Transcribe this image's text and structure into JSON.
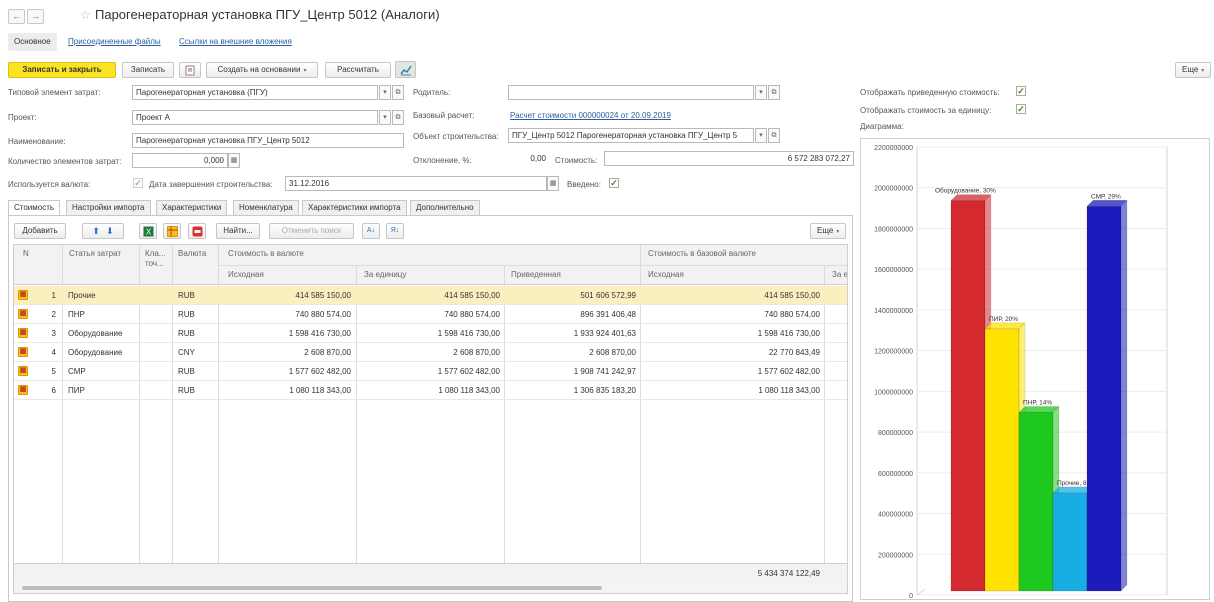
{
  "window": {
    "title": "Парогенераторная установка ПГУ_Центр 5012 (Аналоги)",
    "back_glyph": "←",
    "forward_glyph": "→",
    "star_glyph": "☆"
  },
  "top_tabs": [
    {
      "label": "Основное"
    },
    {
      "label": "Присоединенные файлы"
    },
    {
      "label": "Ссылки на внешние вложения"
    }
  ],
  "toolbar": {
    "save_close": "Записать и закрыть",
    "save": "Записать",
    "create_based": "Создать на основании",
    "calculate": "Рассчитать",
    "more": "Еще"
  },
  "form": {
    "typical_element_label": "Типовой элемент затрат:",
    "typical_element_value": "Парогенераторная установка (ПГУ)",
    "project_label": "Проект:",
    "project_value": "Проект А",
    "name_label": "Наименование:",
    "name_value": "Парогенераторная установка ПГУ_Центр 5012",
    "count_label": "Количество элементов затрат:",
    "count_value": "0,000",
    "currency_label": "Используется валюта:",
    "completion_label": "Дата завершения строительства:",
    "completion_value": "31.12.2016",
    "introduced_label": "Введено:",
    "parent_label": "Родитель:",
    "parent_value": "",
    "base_calc_label": "Базовый расчет:",
    "base_calc_value": "Расчет стоимости 000000024 от 20.09.2019",
    "object_label": "Объект строительства:",
    "object_value": "ПГУ_Центр 5012  Парогенераторная установка ПГУ_Центр 5",
    "deviation_label": "Отклонение, %:",
    "deviation_value": "0,00",
    "cost_label": "Стоимость:",
    "cost_value": "6 572 283 072,27"
  },
  "right_panel": {
    "show_reduced_label": "Отображать приведенную стоимость:",
    "show_unit_label": "Отображать стоимость за единицу:",
    "diagram_label": "Диаграмма:"
  },
  "inner_tabs": [
    {
      "label": "Стоимость"
    },
    {
      "label": "Настройки импорта"
    },
    {
      "label": "Характеристики"
    },
    {
      "label": "Номенклатура"
    },
    {
      "label": "Характеристики импорта"
    },
    {
      "label": "Дополнительно"
    }
  ],
  "table_toolbar": {
    "add": "Добавить",
    "find": "Найти...",
    "cancel_search": "Отменить поиск",
    "more": "Еще"
  },
  "table": {
    "headers": {
      "n": "N",
      "article": "Статья затрат",
      "class": "Кла...",
      "class2": "точ...",
      "currency": "Валюта",
      "cost_in_currency": "Стоимость в валюте",
      "original": "Исходная",
      "per_unit": "За единицу",
      "reduced": "Приведенная",
      "cost_in_base": "Стоимость в базовой валюте",
      "base_original": "Исходная",
      "base_cut": "За е"
    },
    "rows": [
      {
        "n": "1",
        "article": "Прочие",
        "currency": "RUB",
        "original": "414 585 150,00",
        "per_unit": "414 585 150,00",
        "reduced": "501 606 572,99",
        "base_original": "414 585 150,00"
      },
      {
        "n": "2",
        "article": "ПНР",
        "currency": "RUB",
        "original": "740 880 574,00",
        "per_unit": "740 880 574,00",
        "reduced": "896 391 406,48",
        "base_original": "740 880 574,00"
      },
      {
        "n": "3",
        "article": "Оборудование",
        "currency": "RUB",
        "original": "1 598 416 730,00",
        "per_unit": "1 598 416 730,00",
        "reduced": "1 933 924 401,63",
        "base_original": "1 598 416 730,00"
      },
      {
        "n": "4",
        "article": "Оборудование",
        "currency": "CNY",
        "original": "2 608 870,00",
        "per_unit": "2 608 870,00",
        "reduced": "2 608 870,00",
        "base_original": "22 770 843,49"
      },
      {
        "n": "5",
        "article": "СМР",
        "currency": "RUB",
        "original": "1 577 602 482,00",
        "per_unit": "1 577 602 482,00",
        "reduced": "1 908 741 242,97",
        "base_original": "1 577 602 482,00"
      },
      {
        "n": "6",
        "article": "ПИР",
        "currency": "RUB",
        "original": "1 080 118 343,00",
        "per_unit": "1 080 118 343,00",
        "reduced": "1 306 835 183,20",
        "base_original": "1 080 118 343,00"
      }
    ],
    "total": "5 434 374 122,49"
  },
  "chart_data": {
    "type": "bar",
    "title": "",
    "xlabel": "",
    "ylabel": "",
    "ylim": [
      0,
      2200000000
    ],
    "yticks": [
      "0",
      "200000000",
      "400000000",
      "600000000",
      "800000000",
      "1000000000",
      "1200000000",
      "1400000000",
      "1600000000",
      "1800000000",
      "2000000000",
      "2200000000"
    ],
    "categories": [
      "Оборудование",
      "ПИР",
      "ПНР",
      "Прочие",
      "СМР"
    ],
    "values": [
      1936533271,
      1306835183,
      896391406,
      501606573,
      1908741243
    ],
    "labels": [
      "Оборудование, 30%",
      "ПИР, 20%",
      "ПНР, 14%",
      "Прочие, 8",
      "СМР, 29%"
    ],
    "colors": [
      "#d42a2f",
      "#ffe200",
      "#1ec81e",
      "#19aee3",
      "#1c1cbd"
    ],
    "grid": true
  }
}
